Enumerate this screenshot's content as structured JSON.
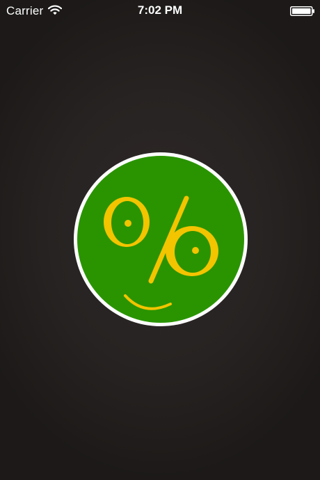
{
  "status_bar": {
    "carrier": "Carrier",
    "time": "7:02 PM",
    "icons": [
      "wifi-icon",
      "battery-icon"
    ]
  },
  "splash": {
    "logo_icon": "smiling-percent-face-icon"
  },
  "colors": {
    "background": "#231f1e",
    "logo_ring": "#ffffff",
    "logo_fill": "#2a9400",
    "logo_symbol": "#f3c400",
    "status_text": "#ffffff"
  }
}
